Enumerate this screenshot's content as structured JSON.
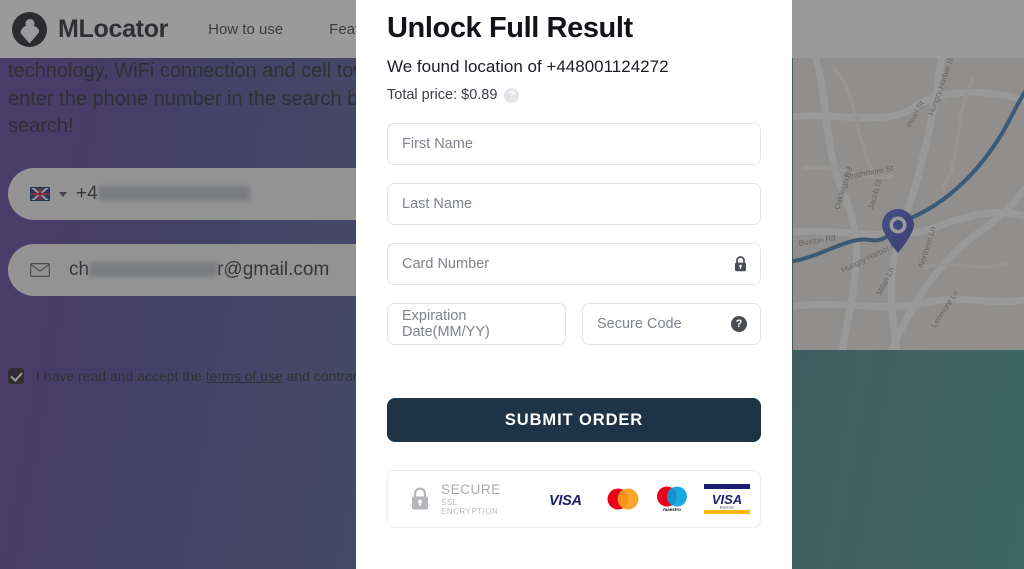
{
  "background": {
    "brand": {
      "name": "MLocator",
      "logo_icon": "location-pin-logo-icon"
    },
    "nav": [
      {
        "label": "How to use"
      },
      {
        "label": "Featur"
      }
    ],
    "hero": {
      "paragraph": "technology, WiFi connection and cell towe\nenter the phone number in the search box\nsearch!",
      "phone_field": {
        "prefix": "+4",
        "country_icon": "uk-flag-icon",
        "caret_icon": "chevron-down-icon"
      },
      "email_field": {
        "icon": "envelope-icon",
        "start": "ch",
        "end": "r@gmail.com"
      },
      "terms": {
        "checked": true,
        "before": "I have read and accept the ",
        "link": "terms of use",
        "after": " and contract an"
      }
    },
    "map": {
      "pin_icon": "map-location-pin-icon",
      "street_labels": [
        "Strathmore St",
        "Pearl St",
        "Hungry Harbor Rd",
        "Oakleigh Rd",
        "Jacob St",
        "Buxton Rd",
        "Hungry Harbor Rd",
        "Milan Ln",
        "Northern Ln",
        "Lenmore Ln"
      ]
    }
  },
  "modal": {
    "title": "Unlock Full Result",
    "subtitle": "We found location of +448001124272",
    "price_label": "Total price: $0.89",
    "price_help_icon": "question-mark-icon",
    "fields": {
      "first_name": {
        "placeholder": "First Name",
        "value": ""
      },
      "last_name": {
        "placeholder": "Last Name",
        "value": ""
      },
      "card_number": {
        "placeholder": "Card Number",
        "value": "",
        "icon": "lock-icon"
      },
      "expiration": {
        "placeholder": "Expiration Date(MM/YY)",
        "value": ""
      },
      "secure_code": {
        "placeholder": "Secure Code",
        "value": "",
        "icon": "question-mark-icon"
      }
    },
    "submit_label": "SUBMIT ORDER",
    "secure_badge": {
      "lock_icon": "lock-icon",
      "title": "SECURE",
      "subtitle": "SSL ENCRYPTION",
      "cards": [
        {
          "name": "visa",
          "label": "VISA"
        },
        {
          "name": "mastercard",
          "label": ""
        },
        {
          "name": "maestro",
          "label": "maestro"
        },
        {
          "name": "visa-electron",
          "label": "VISA",
          "sublabel": "Electron"
        }
      ]
    }
  },
  "colors": {
    "modal_button": "#1e3346",
    "brand_dark": "#12141f",
    "visa_blue": "#1a1f71",
    "mc_red": "#eb001b",
    "mc_orange": "#f79e1b",
    "maestro_blue": "#00a1df",
    "electron_yellow": "#f7b600"
  }
}
